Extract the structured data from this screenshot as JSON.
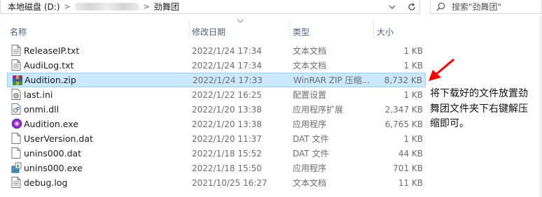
{
  "address": {
    "segments": [
      "本地磁盘 (D:)",
      "劲舞团"
    ],
    "separator": ">"
  },
  "nav": {
    "dropdown_icon": "chevron-down-icon",
    "refresh_icon": "refresh-icon"
  },
  "search": {
    "placeholder": "搜索\"劲舞团\""
  },
  "columns": {
    "name": "名称",
    "date": "修改日期",
    "type": "类型",
    "size": "大小"
  },
  "files": [
    {
      "name": "ReleaseIP.txt",
      "date": "2022/1/24 17:34",
      "type": "文本文档",
      "size": "1 KB",
      "icon": "text-file-icon"
    },
    {
      "name": "AudiLog.txt",
      "date": "2022/1/24 17:34",
      "type": "文本文档",
      "size": "1 KB",
      "icon": "text-file-icon"
    },
    {
      "name": "Audition.zip",
      "date": "2022/1/24 17:33",
      "type": "WinRAR ZIP 压缩...",
      "size": "8,732 KB",
      "icon": "winrar-archive-icon",
      "selected": true
    },
    {
      "name": "last.ini",
      "date": "2022/1/22 16:25",
      "type": "配置设置",
      "size": "1 KB",
      "icon": "settings-file-icon"
    },
    {
      "name": "onmi.dll",
      "date": "2022/1/20 13:38",
      "type": "应用程序扩展",
      "size": "2,347 KB",
      "icon": "dll-file-icon"
    },
    {
      "name": "Audition.exe",
      "date": "2022/1/20 13:38",
      "type": "应用程序",
      "size": "6,765 KB",
      "icon": "audition-app-icon"
    },
    {
      "name": "UserVersion.dat",
      "date": "2022/1/20 11:37",
      "type": "DAT 文件",
      "size": "1 KB",
      "icon": "blank-file-icon"
    },
    {
      "name": "unins000.dat",
      "date": "2022/1/18 15:52",
      "type": "DAT 文件",
      "size": "44 KB",
      "icon": "blank-file-icon"
    },
    {
      "name": "unins000.exe",
      "date": "2022/1/18 15:50",
      "type": "应用程序",
      "size": "701 KB",
      "icon": "installer-icon"
    },
    {
      "name": "debug.log",
      "date": "2021/10/25 16:27",
      "type": "文本文档",
      "size": "11 KB",
      "icon": "text-file-icon"
    }
  ],
  "annotation": {
    "text": "将下载好的文件放置劲舞团文件夹下右键解压缩即可。",
    "arrow_color": "#ff0000"
  }
}
